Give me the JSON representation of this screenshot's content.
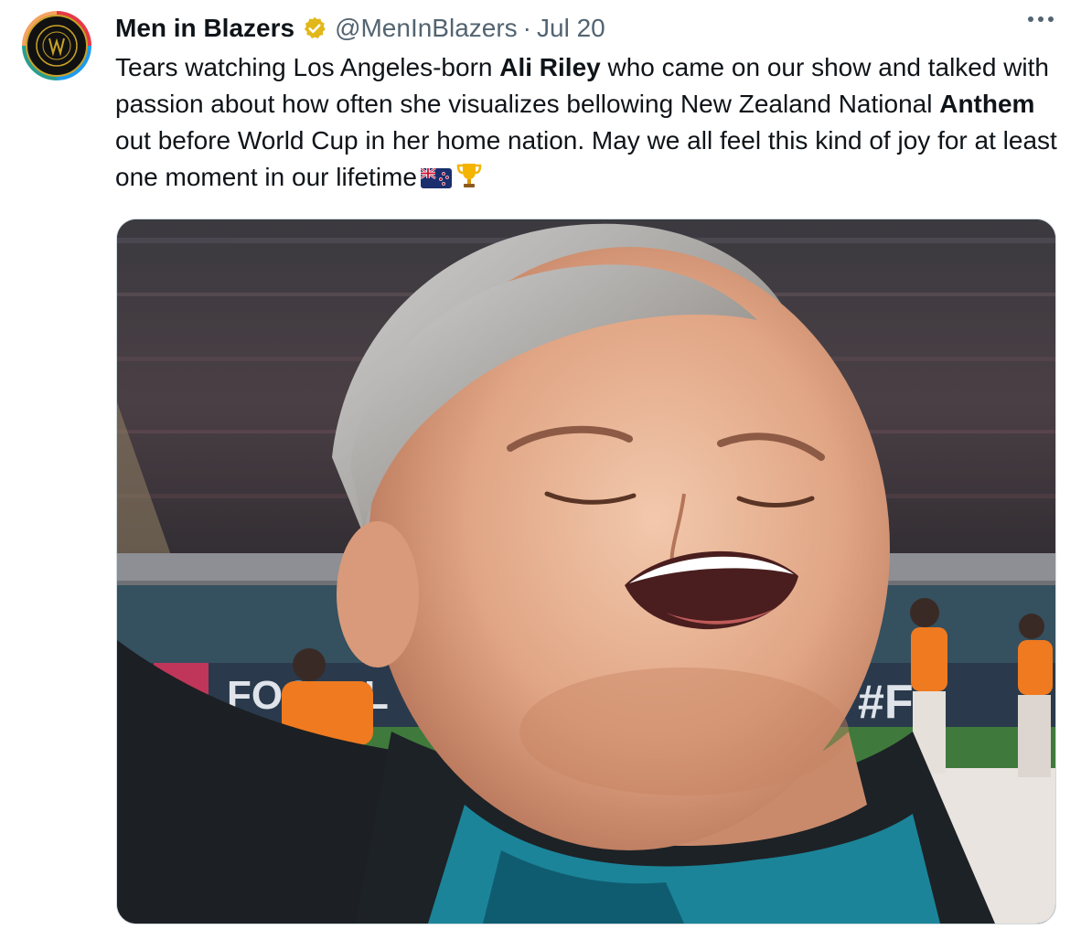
{
  "tweet": {
    "display_name": "Men in Blazers",
    "handle": "@MenInBlazers",
    "separator": "·",
    "date": "Jul 20",
    "text": [
      {
        "t": "Tears watching Los Angeles-born ",
        "bold": false
      },
      {
        "t": "Ali Riley",
        "bold": true
      },
      {
        "t": " who came on our show and talked with passion about how often she visualizes bellowing New Zealand National ",
        "bold": false
      },
      {
        "t": "Anthem",
        "bold": true
      },
      {
        "t": " out before World Cup in her home nation. May we all feel this kind of joy for at least one moment in our lifetime",
        "bold": false
      }
    ],
    "emojis": [
      "new-zealand-flag-icon",
      "trophy-icon"
    ]
  },
  "media": {
    "banner_left": "FOO",
    "banner_left_tail": "L",
    "banner_right": "#F"
  },
  "colors": {
    "verified_badge": "#e2b719",
    "secondary_text": "#536471",
    "accent_orange": "#f07a20",
    "jersey_teal": "#1c8fa6"
  }
}
